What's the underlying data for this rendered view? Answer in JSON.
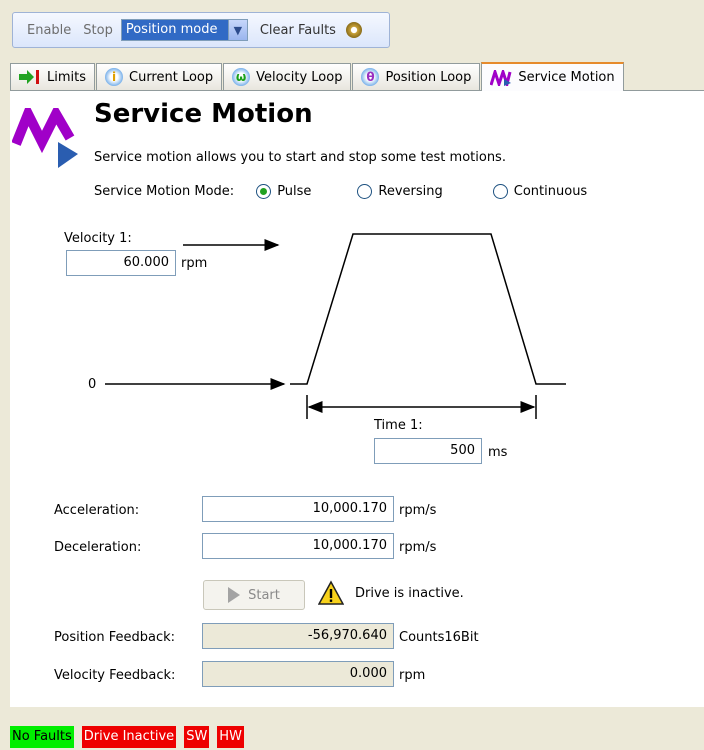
{
  "toolbar": {
    "enable_label": "Enable",
    "stop_label": "Stop",
    "mode_value": "Position mode",
    "clear_faults_label": "Clear Faults"
  },
  "tabs": [
    {
      "label": "Limits",
      "icon": "limits-icon"
    },
    {
      "label": "Current Loop",
      "icon": "current-loop-icon"
    },
    {
      "label": "Velocity Loop",
      "icon": "velocity-loop-icon"
    },
    {
      "label": "Position Loop",
      "icon": "position-loop-icon"
    },
    {
      "label": "Service Motion",
      "icon": "service-motion-icon",
      "active": true
    }
  ],
  "page": {
    "title": "Service Motion",
    "description": "Service motion allows you to start and stop some test motions.",
    "mode_label": "Service Motion Mode:",
    "modes": [
      {
        "label": "Pulse",
        "selected": true
      },
      {
        "label": "Reversing",
        "selected": false
      },
      {
        "label": "Continuous",
        "selected": false
      }
    ]
  },
  "diagram": {
    "velocity_label": "Velocity 1:",
    "velocity_value": "60.000",
    "velocity_unit": "rpm",
    "zero_label": "0",
    "time_label": "Time 1:",
    "time_value": "500",
    "time_unit": "ms"
  },
  "params": {
    "acceleration_label": "Acceleration:",
    "acceleration_value": "10,000.170",
    "acceleration_unit": "rpm/s",
    "deceleration_label": "Deceleration:",
    "deceleration_value": "10,000.170",
    "deceleration_unit": "rpm/s"
  },
  "actions": {
    "start_label": "Start",
    "warning_text": "Drive is inactive."
  },
  "feedback": {
    "position_label": "Position Feedback:",
    "position_value": "-56,970.640",
    "position_unit": "Counts16Bit",
    "velocity_label": "Velocity Feedback:",
    "velocity_value": "0.000",
    "velocity_unit": "rpm"
  },
  "status": {
    "no_faults": "No Faults",
    "drive_inactive": "Drive Inactive",
    "sw": "SW",
    "hw": "HW"
  },
  "colors": {
    "status_ok": "#00ee00",
    "status_fault": "#ee0000",
    "accent_tab": "#e68b2c",
    "logo": "#a000c8"
  }
}
